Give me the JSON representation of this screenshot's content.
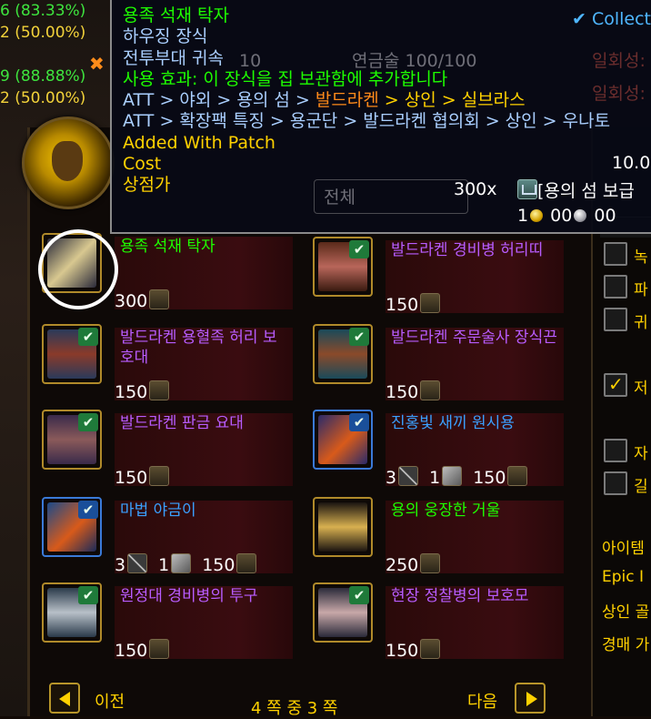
{
  "background_stats": {
    "lines": [
      {
        "text": "6 (83.33%)",
        "color": "green"
      },
      {
        "text": "2 (50.00%)",
        "color": "yellow"
      },
      {
        "text": "",
        "color": "green"
      },
      {
        "text": "9 (88.88%)",
        "color": "green"
      },
      {
        "text": "2 (50.00%)",
        "color": "yellow"
      }
    ],
    "close_mark": "✖"
  },
  "tooltip": {
    "title": "용족 석재 탁자",
    "subtitle": "하우징 장식",
    "binding": "전투부대 귀속",
    "use_effect": "사용 효과: 이 장식을 집 보관함에 추가합니다",
    "collect_label": "Collect",
    "att_line1": {
      "prefix": "ATT > 야외 > 용의 섬 > ",
      "highlight": "발드라켄",
      "suffix": " > 상인 > 실브라스"
    },
    "att_line2": "ATT > 확장팩 특징 > 용군단 > 발드라켄 협의회 > 상인 > 우나토",
    "patch_label": "Added With Patch",
    "patch_value": "10.0",
    "cost_label": "Cost",
    "cost_value": "300x",
    "cost_currency": "[용의 섬 보급",
    "vendor_price_label": "상점가",
    "vendor_gold": "1",
    "vendor_silver": "00",
    "vendor_copper": "00"
  },
  "ghost_text": {
    "profession": "연금술 100/100",
    "one_time_1": "일회성:",
    "one_time_2": "일회성:",
    "ten": "10",
    "search_placeholder": "전체"
  },
  "items": [
    {
      "name": "용족 석재 탁자",
      "price": "300",
      "quality": "green",
      "collected": false
    },
    {
      "name": "발드라켄 경비병 허리띠",
      "price": "150",
      "quality": "epic",
      "collected": true
    },
    {
      "name": "발드라켄 용혈족 허리 보호대",
      "price": "150",
      "quality": "epic",
      "collected": true
    },
    {
      "name": "발드라켄 주문술사 장식끈",
      "price": "150",
      "quality": "epic",
      "collected": true
    },
    {
      "name": "발드라켄 판금 요대",
      "price": "150",
      "quality": "epic",
      "collected": true
    },
    {
      "name": "진홍빛 새끼 원시용",
      "price_parts": [
        "3",
        "1",
        "150"
      ],
      "quality": "rare",
      "collected": true
    },
    {
      "name": "마법 야금이",
      "price_parts": [
        "3",
        "1",
        "150"
      ],
      "quality": "rare",
      "collected": true
    },
    {
      "name": "용의 웅장한 거울",
      "price": "250",
      "quality": "green",
      "collected": false
    },
    {
      "name": "원정대 경비병의 투구",
      "price": "150",
      "quality": "epic",
      "collected": true
    },
    {
      "name": "현장 정찰병의 보호모",
      "price": "150",
      "quality": "epic",
      "collected": true
    }
  ],
  "pager": {
    "prev_label": "이전",
    "next_label": "다음",
    "page_text": "4 쪽 중 3 쪽"
  },
  "right_panel": {
    "filters": [
      {
        "label": "녹",
        "checked": false
      },
      {
        "label": "파",
        "checked": false
      },
      {
        "label": "귀",
        "checked": false
      },
      {
        "label": "저",
        "checked": true
      },
      {
        "label": "자",
        "checked": false
      },
      {
        "label": "길",
        "checked": false
      }
    ],
    "item_label": "아이템",
    "epic_label": "Epic I",
    "vendor_gold_label": "상인 골",
    "auction_label": "경매 가"
  },
  "colors": {
    "quality_green": "#1eff00",
    "quality_rare": "#3aa0ff",
    "quality_epic": "#b85cff",
    "gold_text": "#ffd100",
    "tooltip_bg": "#080a16"
  }
}
